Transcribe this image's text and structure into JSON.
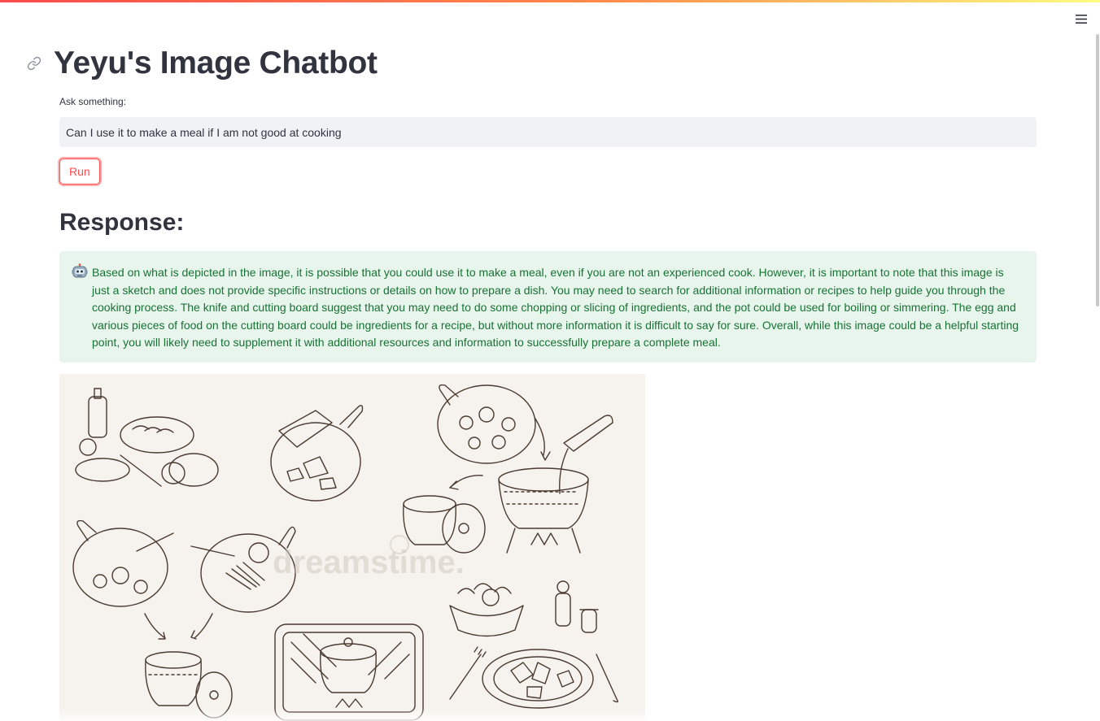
{
  "app": {
    "title": "Yeyu's Image Chatbot"
  },
  "input": {
    "label": "Ask something:",
    "value": "Can I use it to make a meal if I am not good at cooking",
    "placeholder": ""
  },
  "run_button": {
    "label": "Run"
  },
  "response": {
    "heading": "Response:",
    "text": "Based on what is depicted in the image, it is possible that you could use it to make a meal, even if you are not an experienced cook. However, it is important to note that this image is just a sketch and does not provide specific instructions or details on how to prepare a dish. You may need to search for additional information or recipes to help guide you through the cooking process. The knife and cutting board suggest that you may need to do some chopping or slicing of ingredients, and the pot could be used for boiling or simmering. The egg and various pieces of food on the cutting board could be ingredients for a recipe, but without more information it is difficult to say for sure. Overall, while this image could be a helpful starting point, you will likely need to supplement it with additional resources and information to successfully prepare a complete meal.",
    "avatar_icon": "robot-icon",
    "image_watermark": "dreamstime."
  },
  "icons": {
    "menu": "hamburger-menu-icon",
    "anchor": "link-icon"
  },
  "colors": {
    "accent": "#ff4b4b",
    "input_bg": "#f0f2f6",
    "success_bg": "#e8f5ec",
    "success_text": "#177233",
    "text": "#31333f"
  }
}
